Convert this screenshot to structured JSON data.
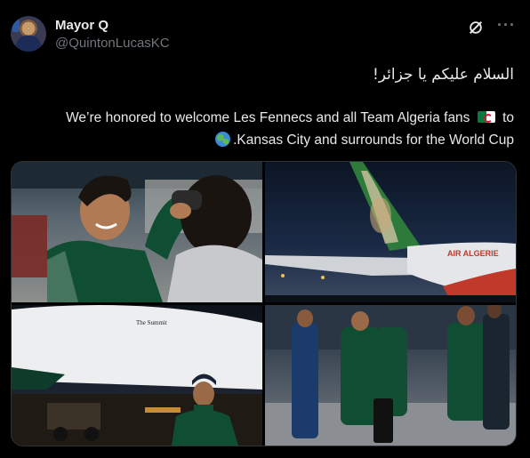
{
  "author": {
    "name": "Mayor Q",
    "handle": "@QuintonLucasKC"
  },
  "icons": {
    "grok": "grok-icon",
    "more": "more-options-icon"
  },
  "more_label": "···",
  "post": {
    "arabic_line": "السلام عليكم يا جزائر!",
    "line1_text": "We’re honored to welcome Les Fennecs and all Team Algeria fans",
    "line1_end": "to",
    "line2_text": ".Kansas City and surrounds for the World Cup"
  },
  "photos": {
    "p2_livery": "AIR ALGERIE",
    "p3_plane_text": "The Summit"
  },
  "colors": {
    "accent_green": "#0a7a3c",
    "algeria_red": "#d21034"
  }
}
